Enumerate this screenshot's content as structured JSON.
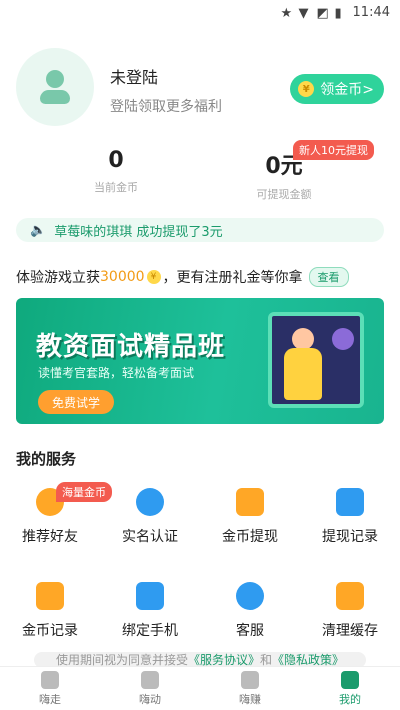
{
  "status_bar": {
    "time": "11:44"
  },
  "profile": {
    "name": "未登陆",
    "subtitle": "登陆领取更多福利",
    "coin_button": "领金币>",
    "coin_symbol": "¥"
  },
  "stats": {
    "coins_value": "0",
    "coins_label": "当前金币",
    "cash_value": "0元",
    "cash_label": "可提现金额",
    "new_badge": "新人10元提现"
  },
  "ticker": {
    "text": "草莓味的琪琪 成功提现了3元"
  },
  "promo": {
    "prefix": "体验游戏立获",
    "amount": "30000",
    "suffix": "，更有注册礼金等你拿",
    "view_button": "查看"
  },
  "banner": {
    "title": "教资面试精品班",
    "subtitle": "读懂考官套路，轻松备考面试",
    "button": "免费试学"
  },
  "services": {
    "title": "我的服务",
    "items": [
      {
        "label": "推荐好友",
        "badge": "海量金币"
      },
      {
        "label": "实名认证"
      },
      {
        "label": "金币提现"
      },
      {
        "label": "提现记录"
      },
      {
        "label": "金币记录"
      },
      {
        "label": "绑定手机"
      },
      {
        "label": "客服"
      },
      {
        "label": "清理缓存"
      }
    ]
  },
  "notice": {
    "prefix": "使用期间视为同意并接受",
    "link1": "《服务协议》",
    "middle": "和",
    "link2": "《隐私政策》"
  },
  "tabs": [
    {
      "label": "嗨走"
    },
    {
      "label": "嗨动"
    },
    {
      "label": "嗨赚"
    },
    {
      "label": "我的",
      "active": true
    }
  ],
  "colors": {
    "accent": "#2fd39b",
    "accent_dark": "#1b9b6c",
    "badge": "#f35b4f",
    "coin": "#ffd84a"
  }
}
